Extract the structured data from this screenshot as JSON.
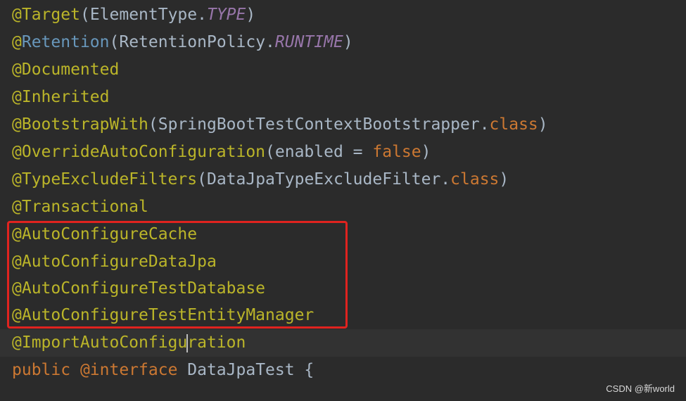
{
  "editor": {
    "colors": {
      "background": "#2b2b2b",
      "annotation": "#bbb529",
      "keyword": "#cc7832",
      "constant": "#9876aa",
      "plain": "#a9b7c6",
      "retention_annotation": "#6897bb",
      "highlight_border": "#e0231f"
    },
    "lines": [
      {
        "at": "@",
        "name": "Target",
        "open": "(",
        "arg": "ElementType.",
        "const": "TYPE",
        "close": ")"
      },
      {
        "at": "@",
        "name": "Retention",
        "open": "(",
        "arg": "RetentionPolicy.",
        "const": "RUNTIME",
        "close": ")"
      },
      {
        "text": "@Documented"
      },
      {
        "text": "@Inherited"
      },
      {
        "name": "@BootstrapWith",
        "open": "(",
        "arg": "SpringBootTestContextBootstrapper.",
        "kw": "class",
        "close": ")"
      },
      {
        "name": "@OverrideAutoConfiguration",
        "open": "(",
        "arg": "enabled = ",
        "kw": "false",
        "close": ")"
      },
      {
        "name": "@TypeExcludeFilters",
        "open": "(",
        "arg": "DataJpaTypeExcludeFilter.",
        "kw": "class",
        "close": ")"
      },
      {
        "text": "@Transactional"
      },
      {
        "text": "@AutoConfigureCache"
      },
      {
        "text": "@AutoConfigureDataJpa"
      },
      {
        "text": "@AutoConfigureTestDatabase"
      },
      {
        "text": "@AutoConfigureTestEntityManager"
      },
      {
        "before_caret": "@ImportAutoConfigu",
        "after_caret": "ration"
      },
      {
        "kw1": "public",
        "ann": " @interface",
        "rest": " DataJpaTest {"
      }
    ]
  },
  "watermark": "CSDN @新world"
}
